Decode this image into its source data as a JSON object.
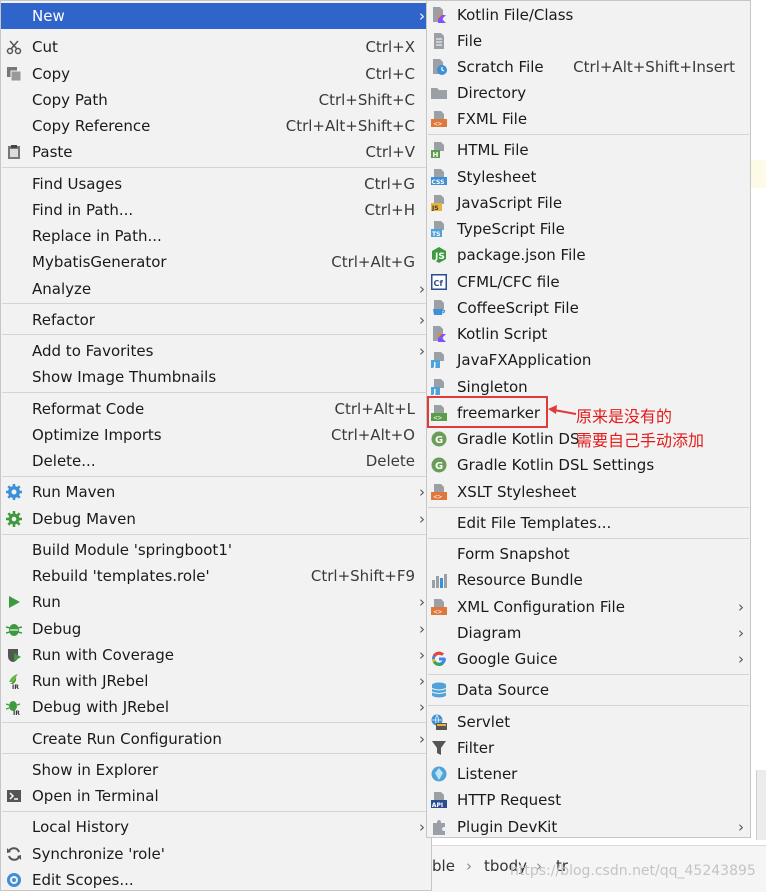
{
  "main_menu": {
    "items": [
      {
        "label": "New",
        "shortcut": "",
        "submenu": true,
        "selected": true
      },
      {
        "label": "Cut",
        "shortcut": "Ctrl+X",
        "submenu": false,
        "icon": "cut-icon"
      },
      {
        "label": "Copy",
        "shortcut": "Ctrl+C",
        "submenu": false,
        "icon": "copy-icon"
      },
      {
        "label": "Copy Path",
        "shortcut": "Ctrl+Shift+C",
        "submenu": false
      },
      {
        "label": "Copy Reference",
        "shortcut": "Ctrl+Alt+Shift+C",
        "submenu": false
      },
      {
        "label": "Paste",
        "shortcut": "Ctrl+V",
        "submenu": false,
        "icon": "paste-icon"
      },
      {
        "label": "Find Usages",
        "shortcut": "Ctrl+G",
        "submenu": false
      },
      {
        "label": "Find in Path...",
        "shortcut": "Ctrl+H",
        "submenu": false
      },
      {
        "label": "Replace in Path...",
        "shortcut": "",
        "submenu": false
      },
      {
        "label": "MybatisGenerator",
        "shortcut": "Ctrl+Alt+G",
        "submenu": false
      },
      {
        "label": "Analyze",
        "shortcut": "",
        "submenu": true
      },
      {
        "label": "Refactor",
        "shortcut": "",
        "submenu": true
      },
      {
        "label": "Add to Favorites",
        "shortcut": "",
        "submenu": true
      },
      {
        "label": "Show Image Thumbnails",
        "shortcut": "",
        "submenu": false
      },
      {
        "label": "Reformat Code",
        "shortcut": "Ctrl+Alt+L",
        "submenu": false
      },
      {
        "label": "Optimize Imports",
        "shortcut": "Ctrl+Alt+O",
        "submenu": false
      },
      {
        "label": "Delete...",
        "shortcut": "Delete",
        "submenu": false
      },
      {
        "label": "Run Maven",
        "shortcut": "",
        "submenu": true,
        "icon": "maven-gear-icon"
      },
      {
        "label": "Debug Maven",
        "shortcut": "",
        "submenu": true,
        "icon": "maven-debug-gear-icon"
      },
      {
        "label": "Build Module 'springboot1'",
        "shortcut": "",
        "submenu": false
      },
      {
        "label": "Rebuild 'templates.role'",
        "shortcut": "Ctrl+Shift+F9",
        "submenu": false
      },
      {
        "label": "Run",
        "shortcut": "",
        "submenu": true,
        "icon": "run-icon"
      },
      {
        "label": "Debug",
        "shortcut": "",
        "submenu": true,
        "icon": "debug-icon"
      },
      {
        "label": "Run with Coverage",
        "shortcut": "",
        "submenu": true,
        "icon": "coverage-icon"
      },
      {
        "label": "Run with JRebel",
        "shortcut": "",
        "submenu": true,
        "icon": "jrebel-run-icon"
      },
      {
        "label": "Debug with JRebel",
        "shortcut": "",
        "submenu": true,
        "icon": "jrebel-debug-icon"
      },
      {
        "label": "Create Run Configuration",
        "shortcut": "",
        "submenu": true
      },
      {
        "label": "Show in Explorer",
        "shortcut": "",
        "submenu": false
      },
      {
        "label": "Open in Terminal",
        "shortcut": "",
        "submenu": false,
        "icon": "terminal-icon"
      },
      {
        "label": "Local History",
        "shortcut": "",
        "submenu": true
      },
      {
        "label": "Synchronize 'role'",
        "shortcut": "",
        "submenu": false,
        "icon": "sync-icon"
      },
      {
        "label": "Edit Scopes...",
        "shortcut": "",
        "submenu": false,
        "icon": "scopes-icon"
      }
    ]
  },
  "new_submenu": {
    "items": [
      {
        "label": "Kotlin File/Class",
        "shortcut": "",
        "submenu": false,
        "icon": "kotlin-file-icon"
      },
      {
        "label": "File",
        "shortcut": "",
        "submenu": false,
        "icon": "text-file-icon"
      },
      {
        "label": "Scratch File",
        "shortcut": "Ctrl+Alt+Shift+Insert",
        "submenu": false,
        "icon": "scratch-file-icon"
      },
      {
        "label": "Directory",
        "shortcut": "",
        "submenu": false,
        "icon": "folder-icon"
      },
      {
        "label": "FXML File",
        "shortcut": "",
        "submenu": false,
        "icon": "fxml-file-icon"
      },
      {
        "label": "HTML File",
        "shortcut": "",
        "submenu": false,
        "icon": "html-file-icon"
      },
      {
        "label": "Stylesheet",
        "shortcut": "",
        "submenu": false,
        "icon": "css-file-icon"
      },
      {
        "label": "JavaScript File",
        "shortcut": "",
        "submenu": false,
        "icon": "js-file-icon"
      },
      {
        "label": "TypeScript File",
        "shortcut": "",
        "submenu": false,
        "icon": "ts-file-icon"
      },
      {
        "label": "package.json File",
        "shortcut": "",
        "submenu": false,
        "icon": "nodejs-icon"
      },
      {
        "label": "CFML/CFC file",
        "shortcut": "",
        "submenu": false,
        "icon": "cfml-icon"
      },
      {
        "label": "CoffeeScript File",
        "shortcut": "",
        "submenu": false,
        "icon": "coffeescript-icon"
      },
      {
        "label": "Kotlin Script",
        "shortcut": "",
        "submenu": false,
        "icon": "kotlin-script-icon"
      },
      {
        "label": "JavaFXApplication",
        "shortcut": "",
        "submenu": false,
        "icon": "javafx-file-icon"
      },
      {
        "label": "Singleton",
        "shortcut": "",
        "submenu": false,
        "icon": "singleton-file-icon"
      },
      {
        "label": "freemarker",
        "shortcut": "",
        "submenu": false,
        "icon": "freemarker-file-icon"
      },
      {
        "label": "Gradle Kotlin DS",
        "shortcut": "",
        "submenu": false,
        "icon": "gradle-icon"
      },
      {
        "label": "Gradle Kotlin DSL Settings",
        "shortcut": "",
        "submenu": false,
        "icon": "gradle-settings-icon"
      },
      {
        "label": "XSLT Stylesheet",
        "shortcut": "",
        "submenu": false,
        "icon": "xslt-file-icon"
      },
      {
        "label": "Edit File Templates...",
        "shortcut": "",
        "submenu": false
      },
      {
        "label": "Form Snapshot",
        "shortcut": "",
        "submenu": false
      },
      {
        "label": "Resource Bundle",
        "shortcut": "",
        "submenu": false,
        "icon": "resource-bundle-icon"
      },
      {
        "label": "XML Configuration File",
        "shortcut": "",
        "submenu": true,
        "icon": "xml-file-icon"
      },
      {
        "label": "Diagram",
        "shortcut": "",
        "submenu": true
      },
      {
        "label": "Google Guice",
        "shortcut": "",
        "submenu": true,
        "icon": "google-icon"
      },
      {
        "label": "Data Source",
        "shortcut": "",
        "submenu": false,
        "icon": "database-icon"
      },
      {
        "label": "Servlet",
        "shortcut": "",
        "submenu": false,
        "icon": "servlet-icon"
      },
      {
        "label": "Filter",
        "shortcut": "",
        "submenu": false,
        "icon": "filter-icon"
      },
      {
        "label": "Listener",
        "shortcut": "",
        "submenu": false,
        "icon": "listener-icon"
      },
      {
        "label": "HTTP Request",
        "shortcut": "",
        "submenu": false,
        "icon": "api-icon"
      },
      {
        "label": "Plugin DevKit",
        "shortcut": "",
        "submenu": true,
        "icon": "plugin-icon"
      }
    ]
  },
  "editor_breadcrumbs": [
    "ble",
    "tbody",
    "tr"
  ],
  "watermark": "https://blog.csdn.net/qq_45243895",
  "annotation": {
    "line1": "原来是没有的",
    "line2": "需要自己手动添加",
    "color": "#e21b1b"
  },
  "colors": {
    "selected": "#2f65ca",
    "menu_bg": "#f2f2f2",
    "annotation": "#e03a3a"
  }
}
